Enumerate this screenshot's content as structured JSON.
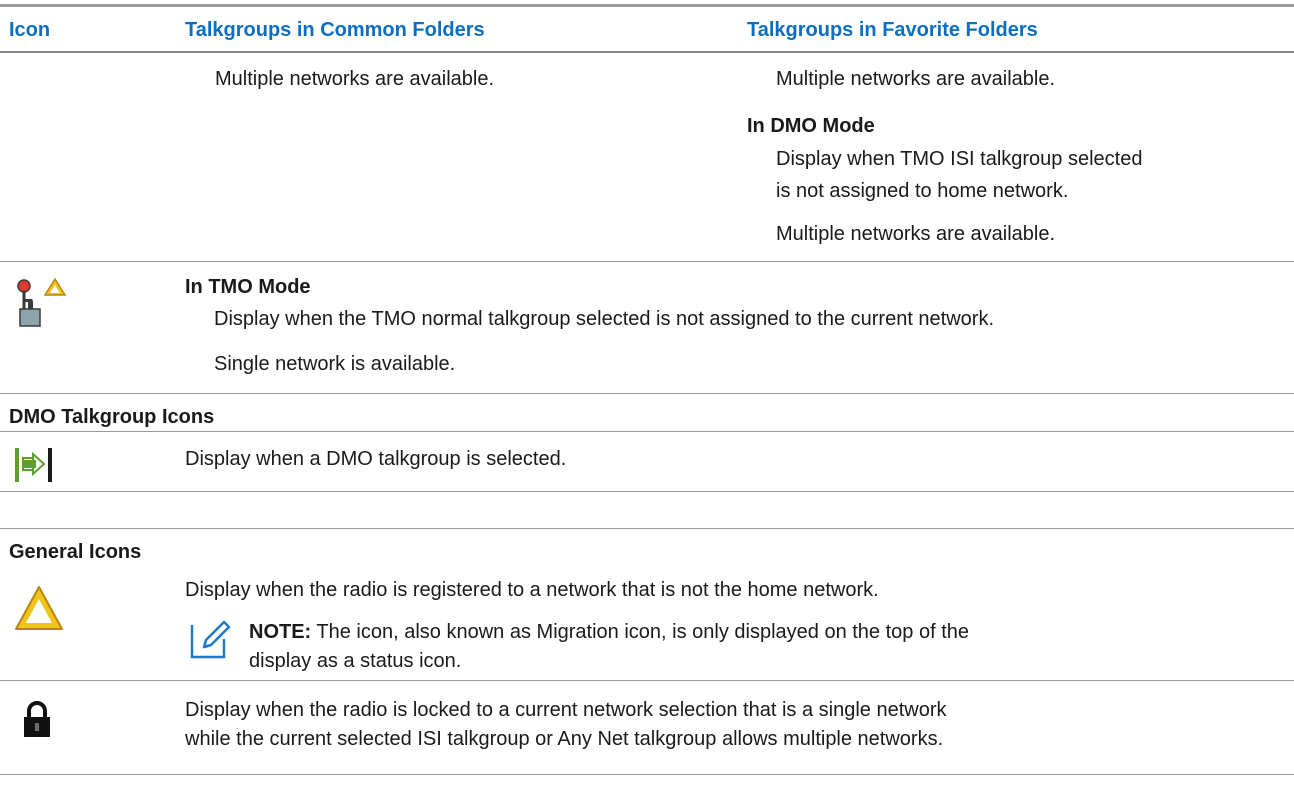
{
  "header": {
    "col_icon": "Icon",
    "col_common": "Talkgroups in Common Folders",
    "col_favorite": "Talkgroups in Favorite Folders"
  },
  "row1": {
    "common_text": "Multiple networks are available.",
    "favorite_text": "Multiple networks are available.",
    "dmo_heading": "In DMO Mode",
    "dmo_text_1": "Display when TMO ISI talkgroup selected",
    "dmo_text_2": "is not assigned to home network.",
    "dmo_text_3": "Multiple networks are available."
  },
  "row_tmo": {
    "icon": "network-unassigned-icon",
    "heading": "In TMO Mode",
    "text_1": "Display when the TMO normal talkgroup selected is not assigned to the current network.",
    "text_2": "Single network is available."
  },
  "section_dmo": {
    "title": "DMO Talkgroup Icons",
    "icon": "dmo-talkgroup-icon",
    "text": "Display when a DMO talkgroup is selected."
  },
  "section_general": {
    "title": "General Icons",
    "migration_icon": "migration-warning-icon",
    "migration_text": "Display when the radio is registered to a network that is not the home network.",
    "note_icon": "note-pencil-icon",
    "note_label": "NOTE:",
    "note_text_1": " The icon, also known as Migration icon, is only displayed on the top of the",
    "note_text_2": "display as a status icon.",
    "lock_icon": "lock-icon",
    "lock_text_1": "Display when the radio is locked to a current network selection that is a single network",
    "lock_text_2": "while the current selected ISI talkgroup or Any Net talkgroup allows multiple networks."
  },
  "colors": {
    "header_blue": "#0a6fc2",
    "rule_gray": "#9a9a9a",
    "dmo_icon_green": "#5a9e2f",
    "warning_yellow": "#f0c419"
  }
}
